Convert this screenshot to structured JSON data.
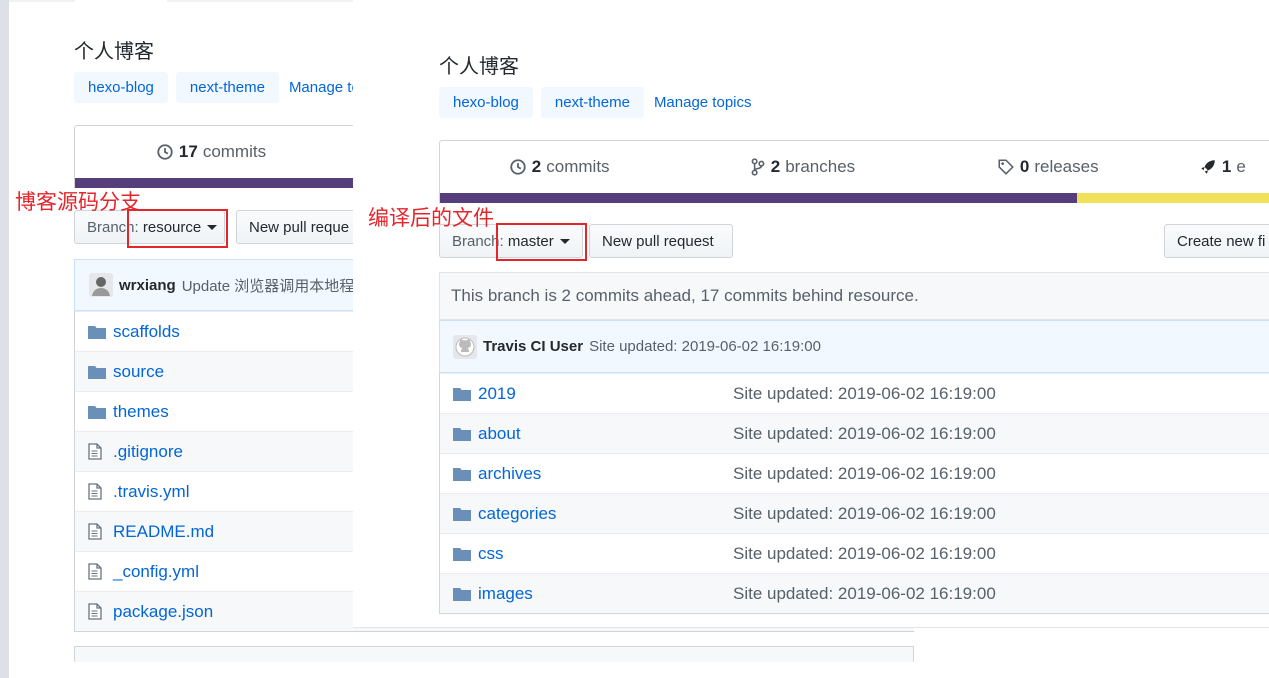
{
  "colors": {
    "link": "#0366d6",
    "topic_bg": "#f1f8ff",
    "annotation": "#e3262b",
    "lang_purple": "#563d7c",
    "lang_yellow": "#f1e05a"
  },
  "left": {
    "description": "个人博客",
    "topics": [
      "hexo-blog",
      "next-theme"
    ],
    "manage_topics": "Manage to",
    "commits": {
      "count": "17",
      "label": "commits"
    },
    "branch": {
      "prefix": "Branch:",
      "name": "resource"
    },
    "new_pull_request": "New pull reque",
    "latest_commit": {
      "author": "wrxiang",
      "message": "Update 浏览器调用本地程",
      "avatar_icon": "user-avatar"
    },
    "files": [
      {
        "name": "scaffolds",
        "type": "folder"
      },
      {
        "name": "source",
        "type": "folder"
      },
      {
        "name": "themes",
        "type": "folder"
      },
      {
        "name": ".gitignore",
        "type": "file"
      },
      {
        "name": ".travis.yml",
        "type": "file"
      },
      {
        "name": "README.md",
        "type": "file"
      },
      {
        "name": "_config.yml",
        "type": "file"
      },
      {
        "name": "package.json",
        "type": "file"
      }
    ]
  },
  "right": {
    "description": "个人博客",
    "topics": [
      "hexo-blog",
      "next-theme"
    ],
    "manage_topics": "Manage topics",
    "stats": {
      "commits": {
        "count": "2",
        "label": "commits"
      },
      "branches": {
        "count": "2",
        "label": "branches"
      },
      "releases": {
        "count": "0",
        "label": "releases"
      },
      "contributors": {
        "count": "1",
        "label": "e"
      }
    },
    "language_bar": [
      {
        "color": "#563d7c",
        "percent": 76
      },
      {
        "color": "#f1e05a",
        "percent": 24
      }
    ],
    "branch": {
      "prefix": "Branch:",
      "name": "master"
    },
    "new_pull_request": "New pull request",
    "create_new_file": "Create new fi",
    "ahead_behind": "This branch is 2 commits ahead, 17 commits behind resource.",
    "latest_commit": {
      "author": "Travis CI User",
      "message": "Site updated: 2019-06-02 16:19:00",
      "avatar_icon": "github-octocat-avatar"
    },
    "files": [
      {
        "name": "2019",
        "message": "Site updated: 2019-06-02 16:19:00"
      },
      {
        "name": "about",
        "message": "Site updated: 2019-06-02 16:19:00"
      },
      {
        "name": "archives",
        "message": "Site updated: 2019-06-02 16:19:00"
      },
      {
        "name": "categories",
        "message": "Site updated: 2019-06-02 16:19:00"
      },
      {
        "name": "css",
        "message": "Site updated: 2019-06-02 16:19:00"
      },
      {
        "name": "images",
        "message": "Site updated: 2019-06-02 16:19:00"
      }
    ]
  },
  "annotations": {
    "left_label": "博客源码分支",
    "right_label": "编译后的文件"
  }
}
